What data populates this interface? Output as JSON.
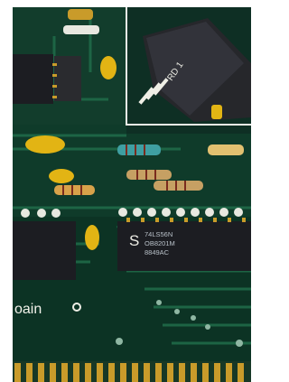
{
  "photo": {
    "subject": "printed circuit board close-up",
    "colors": {
      "board": "#0f3b2a",
      "trace": "#1f6a48",
      "chip": "#1c1d22",
      "gold": "#c99b2a",
      "capacitor": "#e2b414",
      "resistor": "#3f9fa2",
      "silkscreen": "#efefe6"
    }
  },
  "labels": {
    "board_text": "oain",
    "chip_line1": "74LS56N",
    "chip_line2": "OB8201M",
    "chip_line3": "8849AC",
    "chip_logo": "S",
    "rotated_label": "RD 1"
  }
}
